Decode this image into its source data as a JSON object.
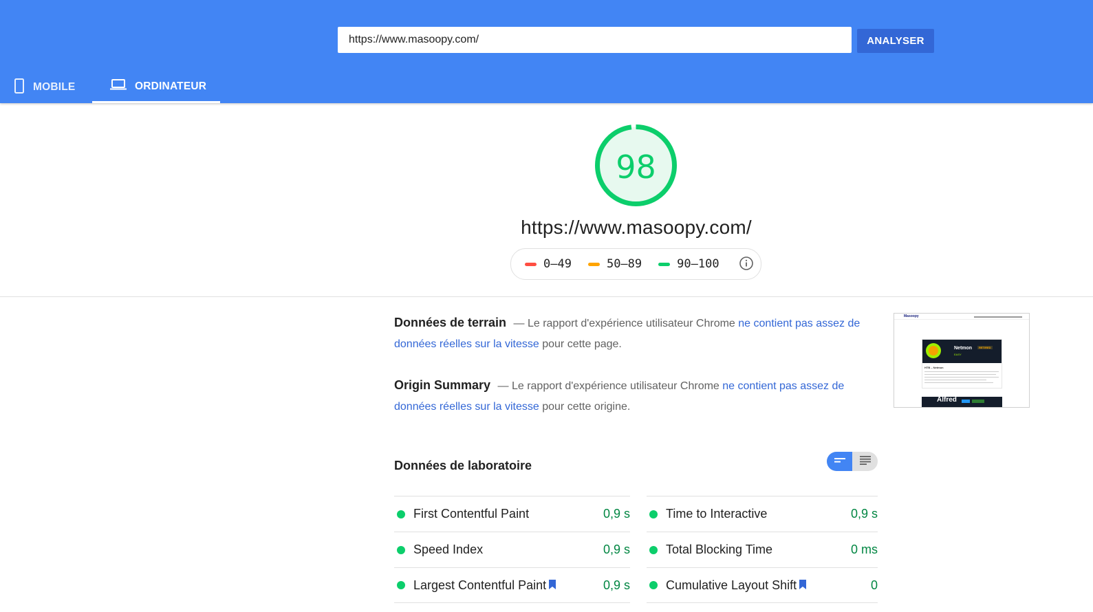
{
  "header": {
    "url_value": "https://www.masoopy.com/",
    "analyze_label": "ANALYSER",
    "tabs": [
      {
        "label": "MOBILE",
        "icon": "smartphone-icon",
        "active": false
      },
      {
        "label": "ORDINATEUR",
        "icon": "laptop-icon",
        "active": true
      }
    ]
  },
  "score": {
    "value": "98",
    "fraction": 0.98,
    "color": "#0cce6b",
    "url": "https://www.masoopy.com/"
  },
  "legend": {
    "items": [
      {
        "label": "0–49",
        "color": "#ff4e42"
      },
      {
        "label": "50–89",
        "color": "#ffa400"
      },
      {
        "label": "90–100",
        "color": "#0cce6b"
      }
    ],
    "info_icon": "info-icon"
  },
  "field_data": {
    "title": "Données de terrain",
    "text_before": "— Le rapport d'expérience utilisateur Chrome",
    "link": "ne contient pas assez de données réelles sur la vitesse",
    "text_after": "pour cette page."
  },
  "origin_summary": {
    "title": "Origin Summary",
    "text_before": "— Le rapport d'expérience utilisateur Chrome",
    "link": "ne contient pas assez de données réelles sur la vitesse",
    "text_after": "pour cette origine."
  },
  "thumbnail": {
    "logo": "Masoopy",
    "card1_title": "Netmon",
    "card1_badge": "RETIRED",
    "card1_sub": "EASY",
    "card1_heading": "HTB – Netmon",
    "card2_title": "Alfred"
  },
  "lab_data": {
    "title": "Données de laboratoire",
    "left_metrics": [
      {
        "name": "First Contentful Paint",
        "value": "0,9 s",
        "flag": false
      },
      {
        "name": "Speed Index",
        "value": "0,9 s",
        "flag": false
      },
      {
        "name": "Largest Contentful Paint",
        "value": "0,9 s",
        "flag": true
      }
    ],
    "right_metrics": [
      {
        "name": "Time to Interactive",
        "value": "0,9 s",
        "flag": false
      },
      {
        "name": "Total Blocking Time",
        "value": "0 ms",
        "flag": false
      },
      {
        "name": "Cumulative Layout Shift",
        "value": "0",
        "flag": true
      }
    ]
  }
}
